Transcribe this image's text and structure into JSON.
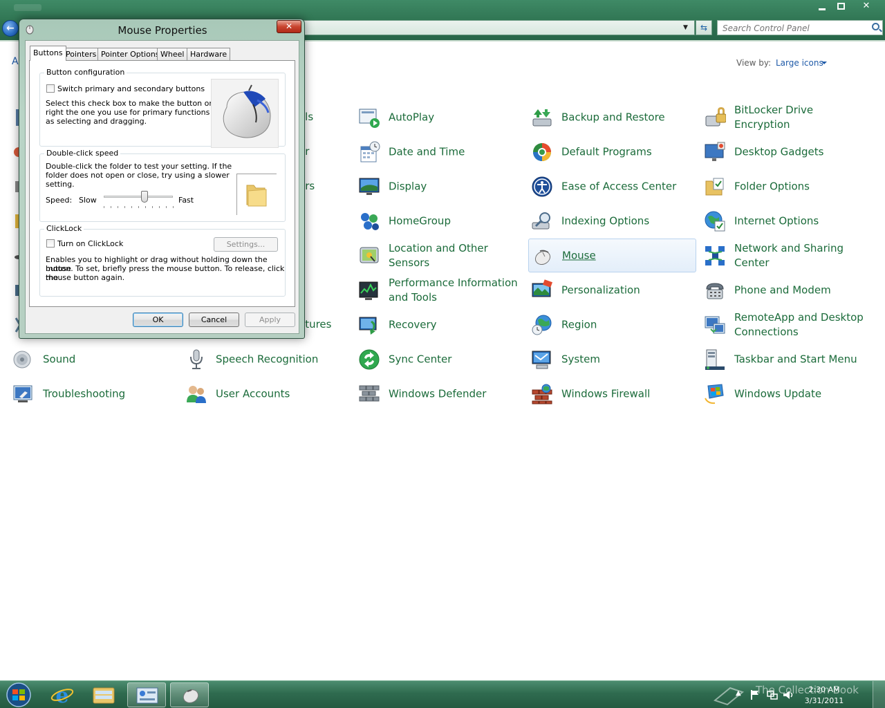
{
  "explorer": {
    "search_placeholder": "Search Control Panel",
    "adjust_text_partial": "Ad",
    "view_by_label": "View by:",
    "view_by_value": "Large icons"
  },
  "items": [
    {
      "label": "AutoPlay",
      "icon": "autoplay-icon",
      "selected": false
    },
    {
      "label": "Backup and Restore",
      "icon": "backup-restore-icon",
      "selected": false
    },
    {
      "label": "BitLocker Drive Encryption",
      "icon": "bitlocker-icon",
      "selected": false
    },
    {
      "label": "Date and Time",
      "icon": "date-time-icon",
      "selected": false
    },
    {
      "label": "Default Programs",
      "icon": "default-programs-icon",
      "selected": false
    },
    {
      "label": "Desktop Gadgets",
      "icon": "desktop-gadgets-icon",
      "selected": false
    },
    {
      "label": "Display",
      "icon": "display-icon",
      "selected": false
    },
    {
      "label": "Ease of Access Center",
      "icon": "ease-of-access-icon",
      "selected": false
    },
    {
      "label": "Folder Options",
      "icon": "folder-options-icon",
      "selected": false
    },
    {
      "label": "HomeGroup",
      "icon": "homegroup-icon",
      "selected": false
    },
    {
      "label": "Indexing Options",
      "icon": "indexing-options-icon",
      "selected": false
    },
    {
      "label": "Internet Options",
      "icon": "internet-options-icon",
      "selected": false
    },
    {
      "label": "Location and Other Sensors",
      "icon": "location-sensors-icon",
      "selected": false
    },
    {
      "label": "Mouse",
      "icon": "mouse-icon",
      "selected": true
    },
    {
      "label": "Network and Sharing Center",
      "icon": "network-sharing-icon",
      "selected": false
    },
    {
      "label": "Performance Information and Tools",
      "icon": "performance-icon",
      "selected": false
    },
    {
      "label": "Personalization",
      "icon": "personalization-icon",
      "selected": false
    },
    {
      "label": "Phone and Modem",
      "icon": "phone-modem-icon",
      "selected": false
    },
    {
      "label": "Recovery",
      "icon": "recovery-icon",
      "selected": false
    },
    {
      "label": "Region",
      "icon": "region-icon",
      "selected": false
    },
    {
      "label": "RemoteApp and Desktop Connections",
      "icon": "remoteapp-icon",
      "selected": false
    },
    {
      "label": "Sound",
      "icon": "sound-icon",
      "selected": false
    },
    {
      "label": "Speech Recognition",
      "icon": "speech-recognition-icon",
      "selected": false
    },
    {
      "label": "Sync Center",
      "icon": "sync-center-icon",
      "selected": false
    },
    {
      "label": "System",
      "icon": "system-icon",
      "selected": false
    },
    {
      "label": "Taskbar and Start Menu",
      "icon": "taskbar-start-icon",
      "selected": false
    },
    {
      "label": "Troubleshooting",
      "icon": "troubleshooting-icon",
      "selected": false
    },
    {
      "label": "User Accounts",
      "icon": "user-accounts-icon",
      "selected": false
    },
    {
      "label": "Windows Defender",
      "icon": "windows-defender-icon",
      "selected": false
    },
    {
      "label": "Windows Firewall",
      "icon": "windows-firewall-icon",
      "selected": false
    },
    {
      "label": "Windows Update",
      "icon": "windows-update-icon",
      "selected": false
    }
  ],
  "partial_labels": [
    "ols",
    "er",
    "ers",
    "atures"
  ],
  "dialog": {
    "title": "Mouse Properties",
    "tabs": [
      "Buttons",
      "Pointers",
      "Pointer Options",
      "Wheel",
      "Hardware"
    ],
    "active_tab": "Buttons",
    "button_config": {
      "title": "Button configuration",
      "checkbox_label": "Switch primary and secondary buttons",
      "checked": false,
      "description": [
        "Select this check box to make the button on the",
        "right the one you use for primary functions such",
        "as selecting and dragging."
      ]
    },
    "double_click": {
      "title": "Double-click speed",
      "description": [
        "Double-click the folder to test your setting. If the",
        "folder does not open or close, try using a slower",
        "setting."
      ],
      "speed_label": "Speed:",
      "slow_label": "Slow",
      "fast_label": "Fast",
      "speed_value": 0.6
    },
    "clicklock": {
      "title": "ClickLock",
      "checkbox_label": "Turn on ClickLock",
      "checked": false,
      "settings_button": "Settings...",
      "description": [
        "Enables you to highlight or drag without holding down the mouse",
        "button. To set, briefly press the mouse button. To release, click the",
        "mouse button again."
      ]
    },
    "ok_button": "OK",
    "cancel_button": "Cancel",
    "apply_button": "Apply"
  },
  "taskbar": {
    "time": "2:30 AM",
    "date": "3/31/2011",
    "watermark": "The Collection Book",
    "pinned": [
      "internet-explorer-icon",
      "windows-explorer-icon",
      "control-panel-icon",
      "mouse-properties-icon"
    ]
  },
  "colors": {
    "link_green": "#1b6b3a",
    "link_blue": "#1e5aa8",
    "titlebar": "#2f7452"
  }
}
